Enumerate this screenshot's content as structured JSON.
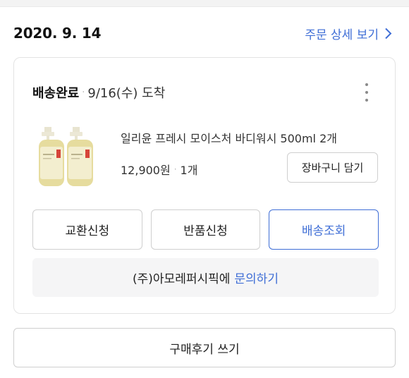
{
  "order": {
    "date": "2020. 9. 14",
    "detail_link_label": "주문 상세 보기",
    "detail_link_icon": "chevron-right-icon"
  },
  "delivery": {
    "status": "배송완료",
    "arrival": "9/16(수) 도착",
    "more_icon": "more-vertical-icon"
  },
  "product": {
    "name": "일리윤 프레시 모이스처 바디워시 500ml 2개",
    "price": "12,900원",
    "quantity": "1개",
    "cart_button_label": "장바구니 담기"
  },
  "actions": {
    "exchange_label": "교환신청",
    "return_label": "반품신청",
    "track_label": "배송조회"
  },
  "inquiry": {
    "seller": "(주)아모레퍼시픽에",
    "link_label": "문의하기"
  },
  "review_button_label": "구매후기 쓰기",
  "colors": {
    "accent": "#3f6ed6",
    "border": "#cfcfcf",
    "inquiry_bg": "#f5f5f6"
  }
}
